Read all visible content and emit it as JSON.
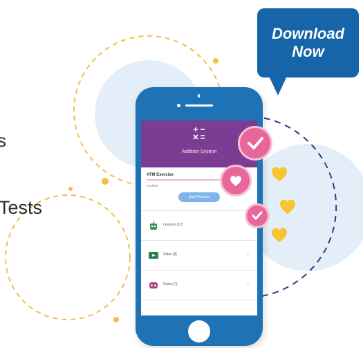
{
  "sidebar": {
    "partial_text_1": "s",
    "partial_text_2": "Tests"
  },
  "download_button": {
    "line1": "Download",
    "line2": "Now"
  },
  "app": {
    "title": "Addition System",
    "section_title": "ATM Exercise",
    "section_sub": "Lecture",
    "start_label": "Start Practice",
    "items": [
      {
        "icon": "robot-icon",
        "label": "Lessons [12]"
      },
      {
        "icon": "video-icon",
        "label": "Video [8]"
      },
      {
        "icon": "game-icon",
        "label": "Game [7]"
      }
    ]
  },
  "colors": {
    "brand_blue": "#1565a8",
    "phone_blue": "#1e73b6",
    "header_purple": "#7b3d91",
    "badge_pink": "#e8679a",
    "heart_yellow": "#f7c531",
    "dash_yellow": "#f2c040",
    "dash_navy": "#2b3a8c"
  }
}
